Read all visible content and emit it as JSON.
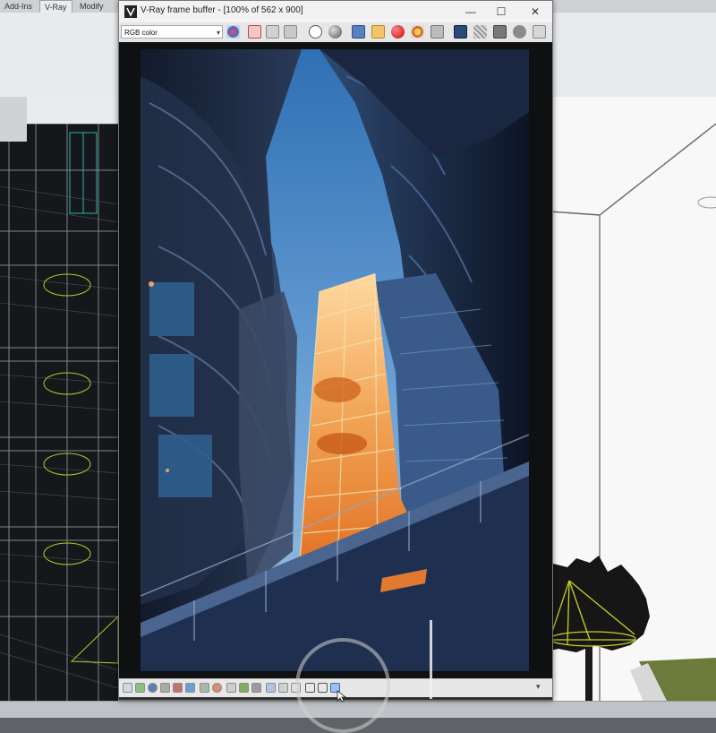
{
  "app": {
    "ribbon_tabs": [
      "Add-Ins",
      "V-Ray",
      "Modify"
    ],
    "active_tab": "V-Ray"
  },
  "vfb": {
    "title": "V-Ray frame buffer - [100% of 562 x 900]",
    "channel_select": "RGB color",
    "window_buttons": [
      "minimize",
      "maximize",
      "close"
    ],
    "toolbar_icons": [
      "color-picker-icon",
      "red-channel-icon",
      "green-channel-icon",
      "blue-channel-icon",
      "alpha-circle-icon",
      "mono-icon",
      "save-image-icon",
      "load-image-icon",
      "clear-image-icon",
      "track-mouse-icon",
      "pan-icon",
      "render-region-icon",
      "link-icon",
      "history-icon",
      "lens-effects-icon",
      "stamp-icon",
      "render-icon"
    ],
    "bottom_toolbar_icons": [
      "display-correction-icon",
      "srgb-icon",
      "lut-icon",
      "ocio-icon",
      "exposure-icon",
      "white-balance-icon",
      "levels-icon",
      "curves-icon",
      "background-icon",
      "hdr-icon",
      "histogram-icon",
      "stats-icon",
      "zoom-icon",
      "info-icon",
      "compare-ab-icon",
      "compare-ab-vertical-icon",
      "compare-ab-horizontal-icon"
    ]
  },
  "colors": {
    "sky_top": "#2f6fb3",
    "sky_bottom": "#9fc2e0",
    "elevator_glow": "#f0a050",
    "building_dark": "#1a2436",
    "window_chrome": "#f2f2f2"
  }
}
